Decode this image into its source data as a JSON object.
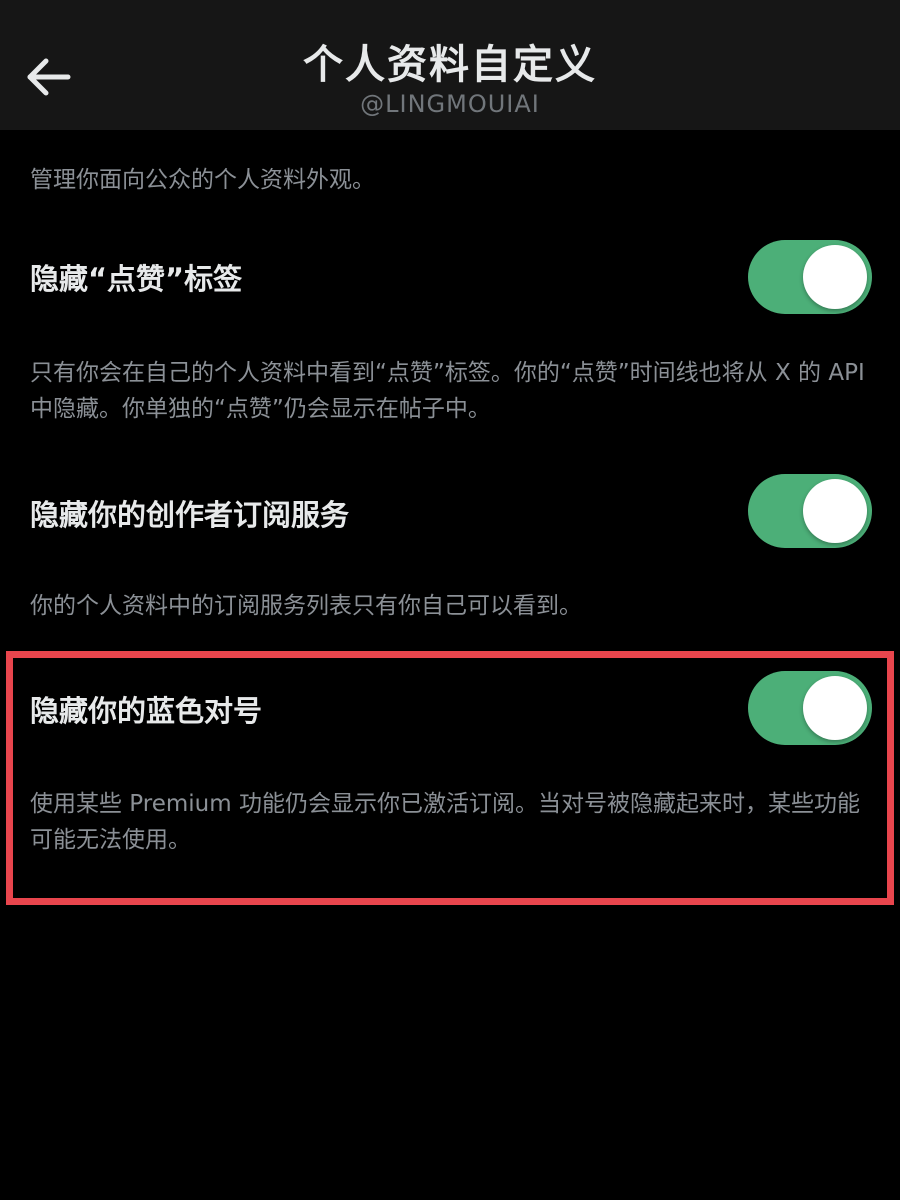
{
  "header": {
    "title": "个人资料自定义",
    "subtitle": "@LINGMOUIAI",
    "back_icon": "arrow-left-icon"
  },
  "intro": "管理你面向公众的个人资料外观。",
  "settings": [
    {
      "label": "隐藏“点赞”标签",
      "description": "只有你会在自己的个人资料中看到“点赞”标签。你的“点赞”时间线也将从 X 的 API 中隐藏。你单独的“点赞”仍会显示在帖子中。",
      "enabled": true
    },
    {
      "label": "隐藏你的创作者订阅服务",
      "description": "你的个人资料中的订阅服务列表只有你自己可以看到。",
      "enabled": true
    },
    {
      "label": "隐藏你的蓝色对号",
      "description": "使用某些 Premium 功能仍会显示你已激活订阅。当对号被隐藏起来时，某些功能可能无法使用。",
      "enabled": true
    }
  ],
  "colors": {
    "background": "#000000",
    "header_background": "#161616",
    "toggle_on": "#4caf78",
    "highlight_border": "#e8454d",
    "secondary_text": "#8b9096"
  }
}
